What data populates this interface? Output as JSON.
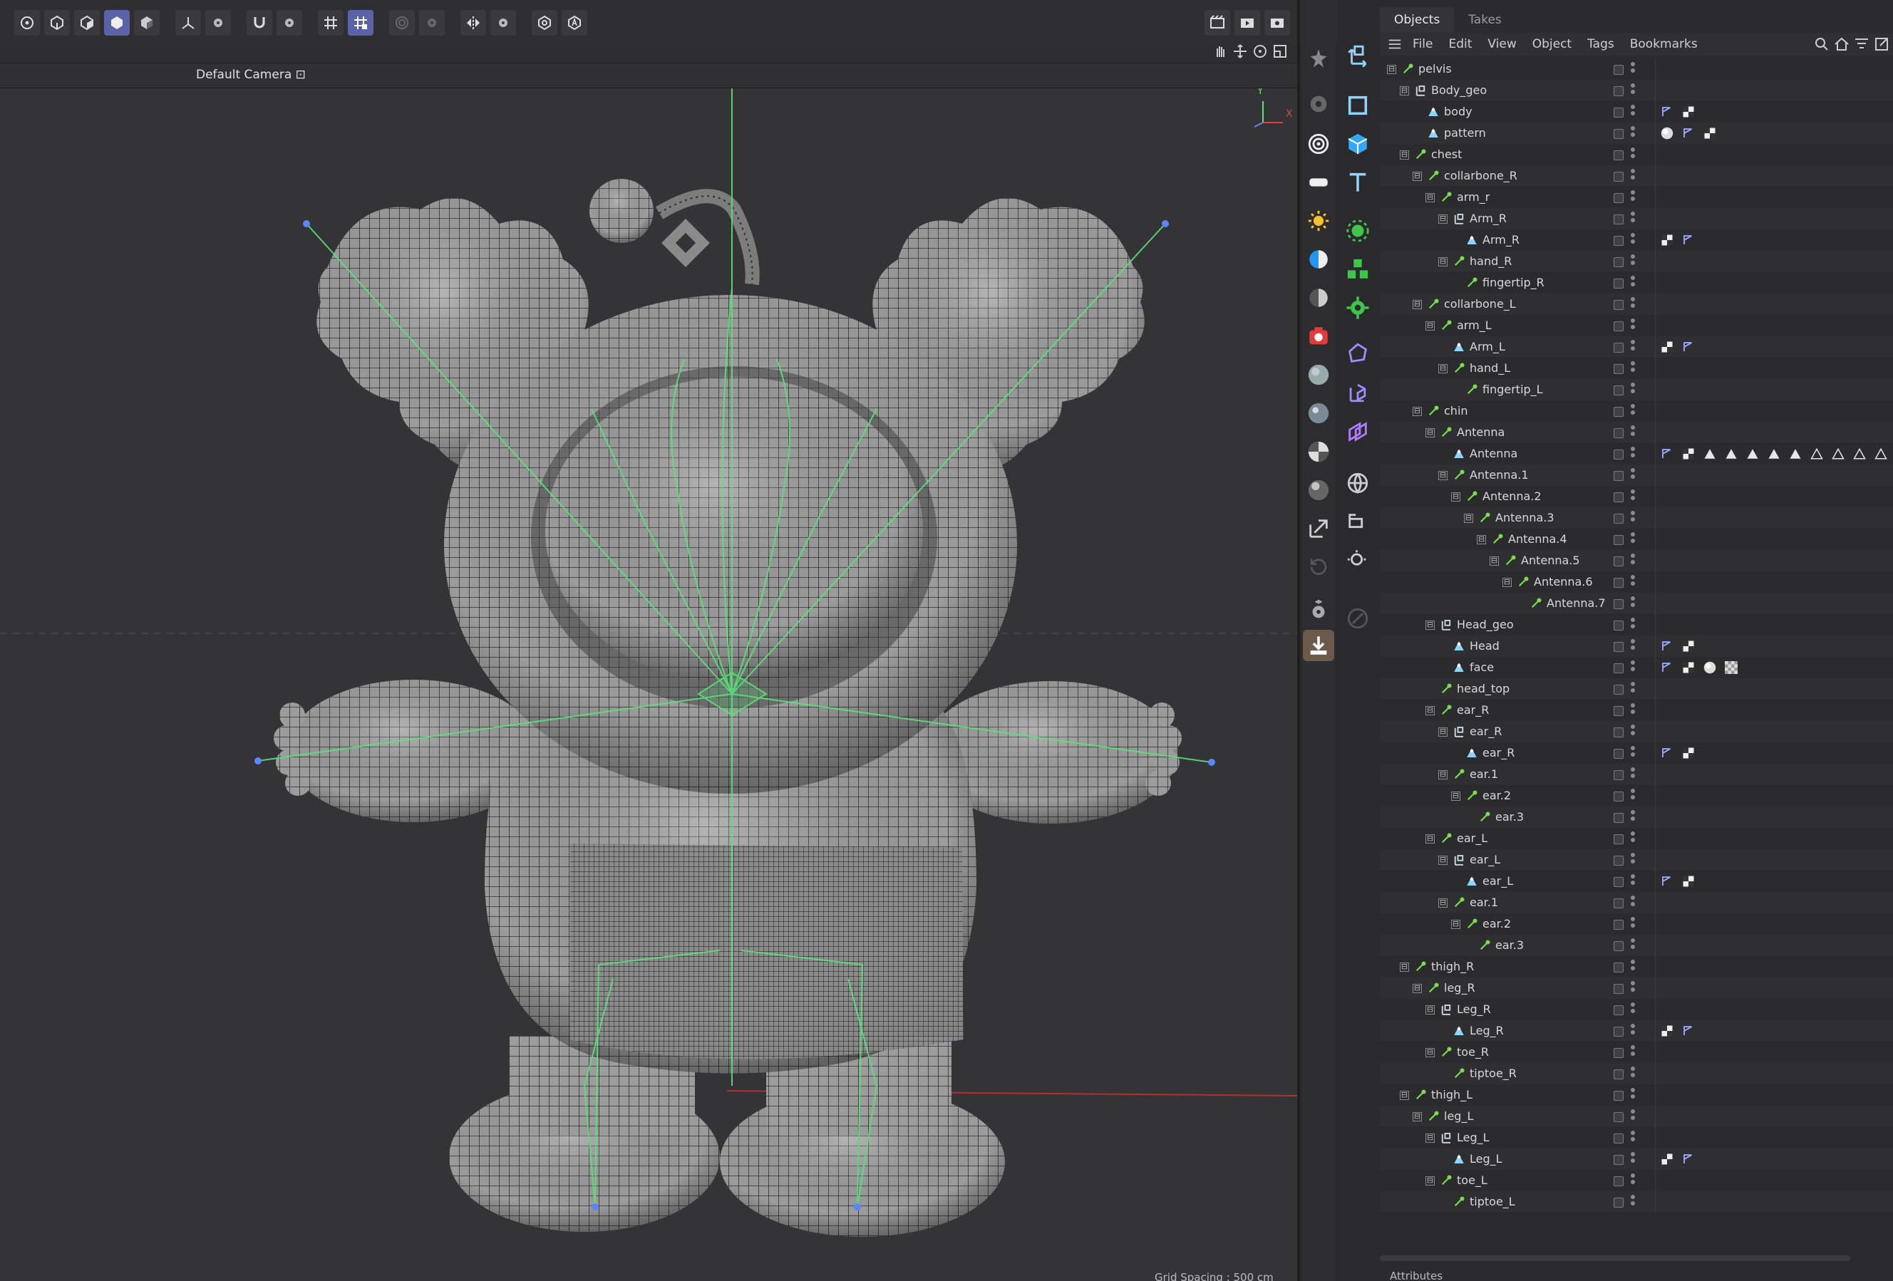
{
  "viewport": {
    "camera_label": "Default Camera ⊡",
    "axis_y": "Y",
    "axis_x": "X",
    "grid_spacing": "Grid Spacing : 500 cm"
  },
  "top_toolbar": {
    "icons": [
      "point-mode-icon",
      "edge-mode-icon",
      "polygon-mode-icon",
      "model-mode-icon",
      "texture-mode-icon",
      "axis-icon",
      "axis-settings-icon",
      "magnet-icon",
      "magnet-settings-icon",
      "snap-grid-icon",
      "snap-active-icon",
      "soft-select-icon",
      "soft-select-settings-icon",
      "symmetry-icon",
      "symmetry-settings-icon",
      "workplane-icon",
      "auto-icon"
    ],
    "right_icons": [
      "render-view-icon",
      "render-picture-icon",
      "render-settings-icon",
      "render-queue-icon"
    ]
  },
  "viewport_nav": [
    "pan-icon",
    "move-icon",
    "rotate-icon",
    "maximize-icon"
  ],
  "objects_panel": {
    "tabs": [
      "Objects",
      "Takes"
    ],
    "active_tab": "Objects",
    "menu": [
      "File",
      "Edit",
      "View",
      "Object",
      "Tags",
      "Bookmarks"
    ],
    "tree": [
      {
        "name": "pelvis",
        "depth": 0,
        "type": "joint",
        "expand": "⊟",
        "tags": []
      },
      {
        "name": "Body_geo",
        "depth": 1,
        "type": "null",
        "expand": "⊟",
        "tags": []
      },
      {
        "name": "body",
        "depth": 2,
        "type": "mesh",
        "expand": "",
        "tags": [
          "weight",
          "checker"
        ]
      },
      {
        "name": "pattern",
        "depth": 2,
        "type": "mesh",
        "expand": "",
        "tags": [
          "sphere",
          "weight",
          "checker"
        ]
      },
      {
        "name": "chest",
        "depth": 1,
        "type": "joint",
        "expand": "⊟",
        "tags": []
      },
      {
        "name": "collarbone_R",
        "depth": 2,
        "type": "joint",
        "expand": "⊟",
        "tags": []
      },
      {
        "name": "arm_r",
        "depth": 3,
        "type": "joint",
        "expand": "⊟",
        "tags": []
      },
      {
        "name": "Arm_R",
        "depth": 4,
        "type": "null",
        "expand": "⊟",
        "tags": []
      },
      {
        "name": "Arm_R",
        "depth": 5,
        "type": "mesh",
        "expand": "",
        "tags": [
          "checker",
          "weight"
        ]
      },
      {
        "name": "hand_R",
        "depth": 4,
        "type": "joint",
        "expand": "⊟",
        "tags": []
      },
      {
        "name": "fingertip_R",
        "depth": 5,
        "type": "joint",
        "expand": "",
        "tags": []
      },
      {
        "name": "collarbone_L",
        "depth": 2,
        "type": "joint",
        "expand": "⊟",
        "tags": []
      },
      {
        "name": "arm_L",
        "depth": 3,
        "type": "joint",
        "expand": "⊟",
        "tags": []
      },
      {
        "name": "Arm_L",
        "depth": 4,
        "type": "mesh",
        "expand": "",
        "tags": [
          "checker",
          "weight"
        ]
      },
      {
        "name": "hand_L",
        "depth": 4,
        "type": "joint",
        "expand": "⊟",
        "tags": []
      },
      {
        "name": "fingertip_L",
        "depth": 5,
        "type": "joint",
        "expand": "",
        "tags": []
      },
      {
        "name": "chin",
        "depth": 2,
        "type": "joint",
        "expand": "⊟",
        "tags": []
      },
      {
        "name": "Antenna",
        "depth": 3,
        "type": "joint",
        "expand": "⊟",
        "tags": []
      },
      {
        "name": "Antenna",
        "depth": 4,
        "type": "mesh",
        "expand": "",
        "tags": [
          "weight",
          "checker",
          "tri",
          "tri",
          "tri",
          "tri",
          "tri",
          "tri-outline",
          "tri-outline",
          "tri-outline",
          "tri-outline"
        ]
      },
      {
        "name": "Antenna.1",
        "depth": 4,
        "type": "joint",
        "expand": "⊟",
        "tags": []
      },
      {
        "name": "Antenna.2",
        "depth": 5,
        "type": "joint",
        "expand": "⊟",
        "tags": []
      },
      {
        "name": "Antenna.3",
        "depth": 6,
        "type": "joint",
        "expand": "⊟",
        "tags": []
      },
      {
        "name": "Antenna.4",
        "depth": 7,
        "type": "joint",
        "expand": "⊟",
        "tags": []
      },
      {
        "name": "Antenna.5",
        "depth": 8,
        "type": "joint",
        "expand": "⊟",
        "tags": []
      },
      {
        "name": "Antenna.6",
        "depth": 9,
        "type": "joint",
        "expand": "⊟",
        "tags": []
      },
      {
        "name": "Antenna.7",
        "depth": 10,
        "type": "joint",
        "expand": "",
        "tags": []
      },
      {
        "name": "Head_geo",
        "depth": 3,
        "type": "null",
        "expand": "⊟",
        "tags": []
      },
      {
        "name": "Head",
        "depth": 4,
        "type": "mesh",
        "expand": "",
        "tags": [
          "weight",
          "checker"
        ]
      },
      {
        "name": "face",
        "depth": 4,
        "type": "mesh",
        "expand": "",
        "tags": [
          "weight",
          "checker",
          "sphere",
          "checker-big"
        ]
      },
      {
        "name": "head_top",
        "depth": 3,
        "type": "joint",
        "expand": "",
        "tags": []
      },
      {
        "name": "ear_R",
        "depth": 3,
        "type": "joint",
        "expand": "⊟",
        "tags": []
      },
      {
        "name": "ear_R",
        "depth": 4,
        "type": "null",
        "expand": "⊟",
        "tags": []
      },
      {
        "name": "ear_R",
        "depth": 5,
        "type": "mesh",
        "expand": "",
        "tags": [
          "weight",
          "checker"
        ]
      },
      {
        "name": "ear.1",
        "depth": 4,
        "type": "joint",
        "expand": "⊟",
        "tags": []
      },
      {
        "name": "ear.2",
        "depth": 5,
        "type": "joint",
        "expand": "⊟",
        "tags": []
      },
      {
        "name": "ear.3",
        "depth": 6,
        "type": "joint",
        "expand": "",
        "tags": []
      },
      {
        "name": "ear_L",
        "depth": 3,
        "type": "joint",
        "expand": "⊟",
        "tags": []
      },
      {
        "name": "ear_L",
        "depth": 4,
        "type": "null",
        "expand": "⊟",
        "tags": []
      },
      {
        "name": "ear_L",
        "depth": 5,
        "type": "mesh",
        "expand": "",
        "tags": [
          "weight",
          "checker"
        ]
      },
      {
        "name": "ear.1",
        "depth": 4,
        "type": "joint",
        "expand": "⊟",
        "tags": []
      },
      {
        "name": "ear.2",
        "depth": 5,
        "type": "joint",
        "expand": "⊟",
        "tags": []
      },
      {
        "name": "ear.3",
        "depth": 6,
        "type": "joint",
        "expand": "",
        "tags": []
      },
      {
        "name": "thigh_R",
        "depth": 1,
        "type": "joint",
        "expand": "⊟",
        "tags": []
      },
      {
        "name": "leg_R",
        "depth": 2,
        "type": "joint",
        "expand": "⊟",
        "tags": []
      },
      {
        "name": "Leg_R",
        "depth": 3,
        "type": "null",
        "expand": "⊟",
        "tags": []
      },
      {
        "name": "Leg_R",
        "depth": 4,
        "type": "mesh",
        "expand": "",
        "tags": [
          "checker",
          "weight"
        ]
      },
      {
        "name": "toe_R",
        "depth": 3,
        "type": "joint",
        "expand": "⊟",
        "tags": []
      },
      {
        "name": "tiptoe_R",
        "depth": 4,
        "type": "joint",
        "expand": "",
        "tags": []
      },
      {
        "name": "thigh_L",
        "depth": 1,
        "type": "joint",
        "expand": "⊟",
        "tags": []
      },
      {
        "name": "leg_L",
        "depth": 2,
        "type": "joint",
        "expand": "⊟",
        "tags": []
      },
      {
        "name": "Leg_L",
        "depth": 3,
        "type": "null",
        "expand": "⊟",
        "tags": []
      },
      {
        "name": "Leg_L",
        "depth": 4,
        "type": "mesh",
        "expand": "",
        "tags": [
          "checker",
          "weight"
        ]
      },
      {
        "name": "toe_L",
        "depth": 3,
        "type": "joint",
        "expand": "⊟",
        "tags": []
      },
      {
        "name": "tiptoe_L",
        "depth": 4,
        "type": "joint",
        "expand": "",
        "tags": []
      }
    ]
  },
  "bottom_tab": "Attributes",
  "colors": {
    "joint": "#7ed957",
    "mesh": "#8fd3ff",
    "null": "#cfd8e6",
    "active_tool": "#5a63a8",
    "camera_red": "#e23b3b",
    "light_yellow": "#f5c22b"
  }
}
